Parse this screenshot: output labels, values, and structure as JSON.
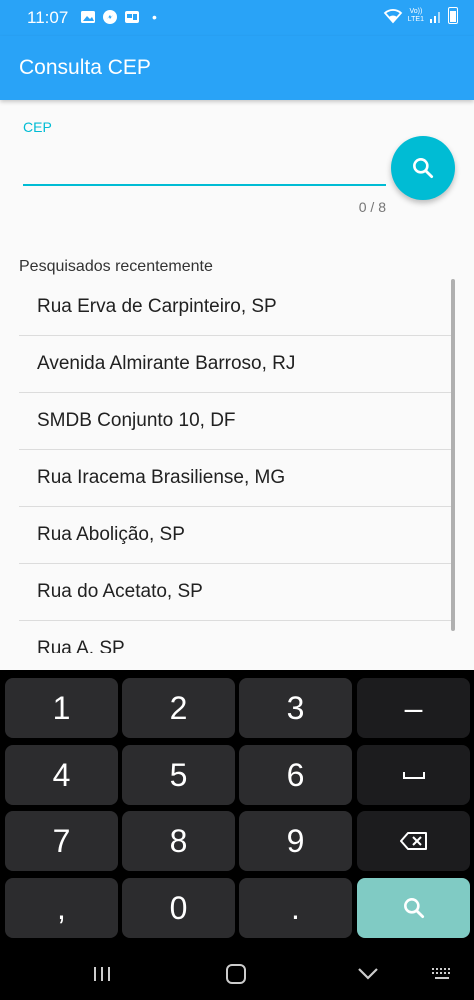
{
  "status": {
    "time": "11:07",
    "dot": "•",
    "network_top": "Vo))",
    "network_bottom": "LTE1"
  },
  "app_bar": {
    "title": "Consulta CEP"
  },
  "cep": {
    "label": "CEP",
    "value": "",
    "counter": "0 / 8"
  },
  "recent": {
    "title": "Pesquisados recentemente",
    "items": [
      "Rua Erva de Carpinteiro, SP",
      "Avenida Almirante Barroso, RJ",
      "SMDB Conjunto 10, DF",
      "Rua Iracema Brasiliense, MG",
      "Rua Abolição, SP",
      "Rua do Acetato, SP",
      "Rua A, SP"
    ]
  },
  "keyboard": {
    "keys": [
      "1",
      "2",
      "3",
      "–",
      "4",
      "5",
      "6",
      "⎵",
      "7",
      "8",
      "9",
      "⌫",
      ",",
      "0",
      ".",
      "search"
    ],
    "colors": {
      "background": "#000000",
      "key": "#2c2c2e",
      "func_key": "#1c1c1e",
      "action_key": "#80cbc4"
    }
  },
  "colors": {
    "primary": "#29a3f7",
    "accent": "#00bcd4"
  }
}
